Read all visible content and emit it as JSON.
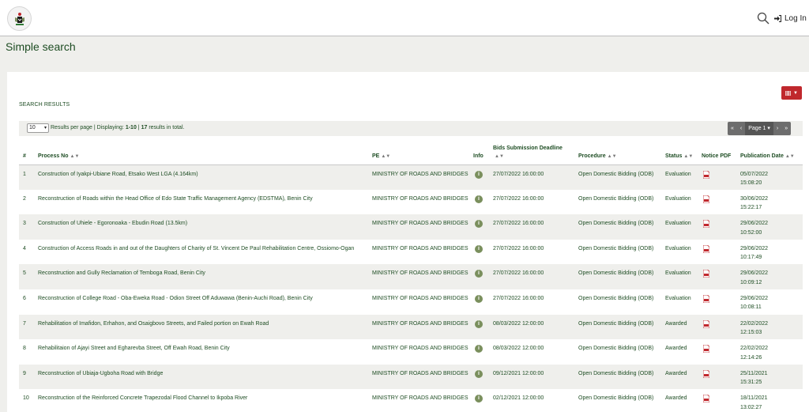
{
  "header": {
    "login_label": "Log In"
  },
  "page_title": "Simple search",
  "results_label": "SEARCH RESULTS",
  "toolbar": {
    "per_page_value": "10",
    "per_page_label": "Results per page | Displaying:",
    "displaying": "1-10",
    "total": "17",
    "total_suffix": "results in total."
  },
  "pager": {
    "first": "«",
    "prev": "‹",
    "page_label": "Page 1",
    "next": "›",
    "last": "»"
  },
  "colors": {
    "accent_green": "#1e4d23",
    "view_button_red": "#c0282d",
    "pager_gray": "#6d6d6d"
  },
  "columns": {
    "num": "#",
    "process_no": "Process No",
    "pe": "PE",
    "info": "Info",
    "bids_deadline": "Bids Submission Deadline",
    "procedure": "Procedure",
    "status": "Status",
    "notice": "Notice PDF",
    "publication": "Publication Date"
  },
  "rows": [
    {
      "num": "1",
      "process": "Construction of Iyakpi-Ubiane Road, Etsako West LGA (4.164km)",
      "pe": "MINISTRY OF ROADS AND BRIDGES",
      "deadline": "27/07/2022 16:00:00",
      "procedure": "Open Domestic Bidding (ODB)",
      "status": "Evaluation",
      "pub_date": "05/07/2022",
      "pub_time": "15:08:20"
    },
    {
      "num": "2",
      "process": "Reconstruction of Roads within the Head Office of Edo State Traffic Management Agency (EDSTMA), Benin City",
      "pe": "MINISTRY OF ROADS AND BRIDGES",
      "deadline": "27/07/2022 16:00:00",
      "procedure": "Open Domestic Bidding (ODB)",
      "status": "Evaluation",
      "pub_date": "30/06/2022",
      "pub_time": "15:22:17"
    },
    {
      "num": "3",
      "process": "Construction of Uhiele - Egoronoaka - Ebudin Road (13.5km)",
      "pe": "MINISTRY OF ROADS AND BRIDGES",
      "deadline": "27/07/2022 16:00:00",
      "procedure": "Open Domestic Bidding (ODB)",
      "status": "Evaluation",
      "pub_date": "29/06/2022",
      "pub_time": "10:52:00"
    },
    {
      "num": "4",
      "process": "Construction of Access Roads in and out of the Daughters of Charity of St. Vincent De Paul Rehabilitation Centre, Ossiomo-Ogan",
      "pe": "MINISTRY OF ROADS AND BRIDGES",
      "deadline": "27/07/2022 16:00:00",
      "procedure": "Open Domestic Bidding (ODB)",
      "status": "Evaluation",
      "pub_date": "29/06/2022",
      "pub_time": "10:17:49"
    },
    {
      "num": "5",
      "process": "Reconstruction and Gully Reclamation of Temboga Road, Benin City",
      "pe": "MINISTRY OF ROADS AND BRIDGES",
      "deadline": "27/07/2022 16:00:00",
      "procedure": "Open Domestic Bidding (ODB)",
      "status": "Evaluation",
      "pub_date": "29/06/2022",
      "pub_time": "10:09:12"
    },
    {
      "num": "6",
      "process": "Reconstruction of College Road - Oba-Eweka Road - Odion Street Off Aduwawa (Benin-Auchi Road), Benin City",
      "pe": "MINISTRY OF ROADS AND BRIDGES",
      "deadline": "27/07/2022 16:00:00",
      "procedure": "Open Domestic Bidding (ODB)",
      "status": "Evaluation",
      "pub_date": "29/06/2022",
      "pub_time": "10:08:11"
    },
    {
      "num": "7",
      "process": "Rehabilitation of Imafidon, Erhahon, and Osaigbovo Streets, and Failed portion on Ewah Road",
      "pe": "MINISTRY OF ROADS AND BRIDGES",
      "deadline": "08/03/2022 12:00:00",
      "procedure": "Open Domestic Bidding (ODB)",
      "status": "Awarded",
      "pub_date": "22/02/2022",
      "pub_time": "12:15:03"
    },
    {
      "num": "8",
      "process": "Rehabilitaion of Ajayi Street and Egharevba Street, Off Ewah Road, Benin City",
      "pe": "MINISTRY OF ROADS AND BRIDGES",
      "deadline": "08/03/2022 12:00:00",
      "procedure": "Open Domestic Bidding (ODB)",
      "status": "Awarded",
      "pub_date": "22/02/2022",
      "pub_time": "12:14:26"
    },
    {
      "num": "9",
      "process": "Reconstruction of Ubiaja-Ugboha Road with Bridge",
      "pe": "MINISTRY OF ROADS AND BRIDGES",
      "deadline": "09/12/2021 12:00:00",
      "procedure": "Open Domestic Bidding (ODB)",
      "status": "Awarded",
      "pub_date": "25/11/2021",
      "pub_time": "15:31:25"
    },
    {
      "num": "10",
      "process": "Reconstruction of the Reinforced Concrete Trapezodal Flood Channel to Ikpoba River",
      "pe": "MINISTRY OF ROADS AND BRIDGES",
      "deadline": "02/12/2021 12:00:00",
      "procedure": "Open Domestic Bidding (ODB)",
      "status": "Awarded",
      "pub_date": "18/11/2021",
      "pub_time": "13:02:27"
    }
  ]
}
